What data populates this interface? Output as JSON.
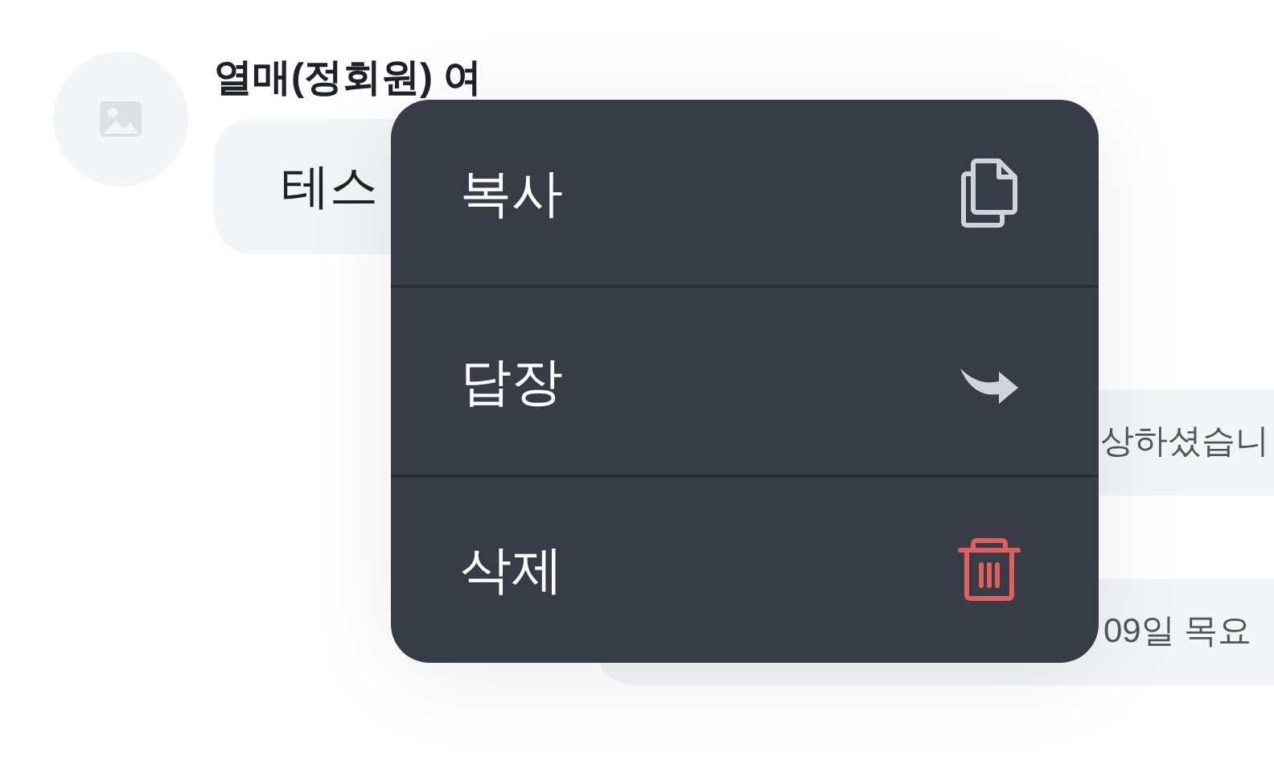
{
  "message": {
    "sender": "열매(정회원) 여",
    "text": "테스"
  },
  "other_messages": [
    {
      "text": "상하셨습니"
    },
    {
      "text": "09일 목요"
    }
  ],
  "context_menu": {
    "items": [
      {
        "label": "복사",
        "kind": "copy"
      },
      {
        "label": "답장",
        "kind": "reply"
      },
      {
        "label": "삭제",
        "kind": "delete"
      }
    ]
  }
}
